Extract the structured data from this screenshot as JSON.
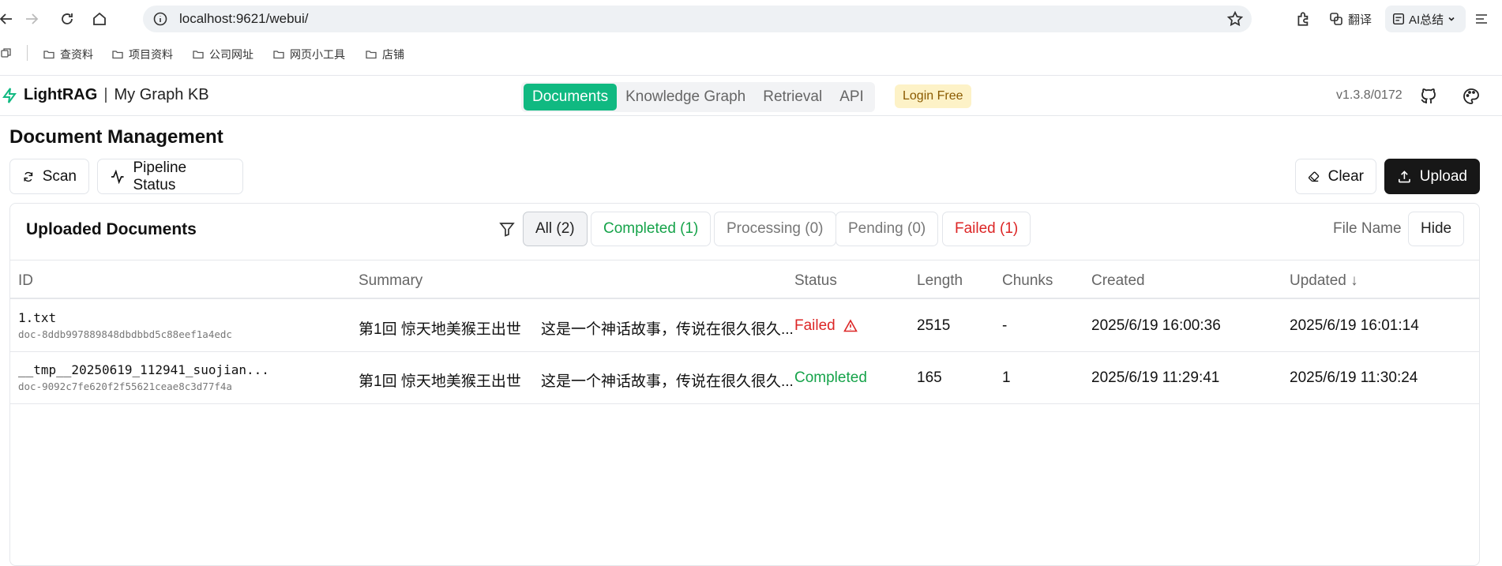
{
  "browser": {
    "url": "localhost:9621/webui/",
    "ext_translate": "翻译",
    "ext_ai": "AI总结",
    "bookmarks": [
      "查资料",
      "项目资料",
      "公司网址",
      "网页小工具",
      "店铺"
    ]
  },
  "header": {
    "brand": "LightRAG",
    "separator": "|",
    "kb_name": "My Graph KB",
    "tabs": [
      "Documents",
      "Knowledge Graph",
      "Retrieval",
      "API"
    ],
    "active_tab": "Documents",
    "login_badge": "Login Free",
    "version": "v1.3.8/0172"
  },
  "page": {
    "title": "Document Management",
    "scan_label": "Scan",
    "pipeline_label": "Pipeline Status",
    "clear_label": "Clear",
    "upload_label": "Upload"
  },
  "panel": {
    "title": "Uploaded Documents",
    "filters": [
      "All (2)",
      "Completed (1)",
      "Processing (0)",
      "Pending (0)",
      "Failed (1)"
    ],
    "file_name_label": "File Name",
    "hide_label": "Hide",
    "columns": [
      "ID",
      "Summary",
      "Status",
      "Length",
      "Chunks",
      "Created",
      "Updated ↓"
    ],
    "rows": [
      {
        "name": "1.txt",
        "doc_id": "doc-8ddb997889848dbdbbd5c88eef1a4edc",
        "summary_title": "第1回 惊天地美猴王出世",
        "summary_text": "这是一个神话故事，传说在很久很久...",
        "status": "Failed",
        "length": "2515",
        "chunks": "-",
        "created": "2025/6/19 16:00:36",
        "updated": "2025/6/19 16:01:14"
      },
      {
        "name": "__tmp__20250619_112941_suojian...",
        "doc_id": "doc-9092c7fe620f2f55621ceae8c3d77f4a",
        "summary_title": "第1回 惊天地美猴王出世",
        "summary_text": "这是一个神话故事，传说在很久很久...",
        "status": "Completed",
        "length": "165",
        "chunks": "1",
        "created": "2025/6/19 11:29:41",
        "updated": "2025/6/19 11:30:24"
      }
    ]
  },
  "colors": {
    "accent": "#10b981",
    "failed": "#dc2626",
    "completed": "#16a34a",
    "upload_bg": "#171717"
  }
}
